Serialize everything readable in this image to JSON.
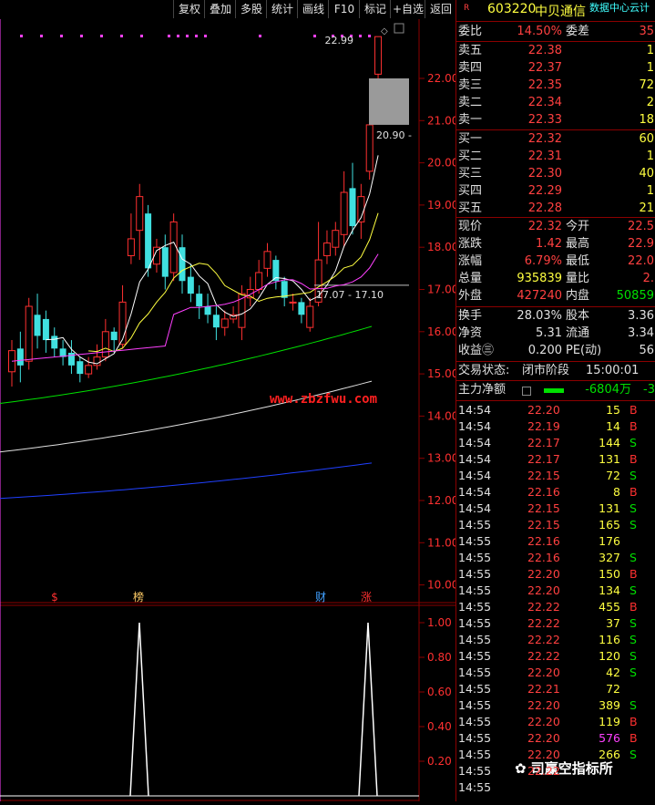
{
  "toolbar": {
    "buttons": [
      "复权",
      "叠加",
      "多股",
      "统计",
      "画线",
      "F10",
      "标记",
      "+自选",
      "返回"
    ]
  },
  "chart": {
    "price_axis_labels": [
      "22.00",
      "21.00",
      "20.00",
      "19.00",
      "18.00",
      "17.00",
      "16.00",
      "15.00",
      "14.00",
      "13.00",
      "12.00",
      "11.00",
      "10.00"
    ],
    "high_label": "22.99",
    "low_gap_label": "20.90 -",
    "ma_label": "17.07 - 17.10",
    "markers": [
      {
        "text": "$",
        "color": "#ff3030"
      },
      {
        "text": "榜",
        "color": "#ffcc66"
      },
      {
        "text": "财",
        "color": "#40a0ff"
      },
      {
        "text": "涨",
        "color": "#ff3030"
      }
    ],
    "indicator_axis_labels": [
      "1.00",
      "0.80",
      "0.60",
      "0.40",
      "0.20"
    ],
    "colors": {
      "up": "#ff3030",
      "down": "#40e0e0",
      "ma5": "#ffffff",
      "ma10": "#ffff40",
      "ma20": "#ff40ff",
      "ma60": "#00e000",
      "ma120": "#e0e0e0",
      "ma250": "#2040ff"
    }
  },
  "watermark": "www.zbzfwu.com",
  "wechat_label": "司赢空指标所",
  "quote": {
    "flag": "R",
    "code": "603220",
    "name": "中贝通信",
    "cloud": "数据中心云计",
    "weibi_label": "委比",
    "weibi_value": "14.50%",
    "weicha_label": "委差",
    "weicha_value": "35",
    "asks": [
      {
        "label": "卖五",
        "price": "22.38",
        "vol": "1"
      },
      {
        "label": "卖四",
        "price": "22.37",
        "vol": "1"
      },
      {
        "label": "卖三",
        "price": "22.35",
        "vol": "72"
      },
      {
        "label": "卖二",
        "price": "22.34",
        "vol": "2"
      },
      {
        "label": "卖一",
        "price": "22.33",
        "vol": "18"
      }
    ],
    "bids": [
      {
        "label": "买一",
        "price": "22.32",
        "vol": "60"
      },
      {
        "label": "买二",
        "price": "22.31",
        "vol": "1"
      },
      {
        "label": "买三",
        "price": "22.30",
        "vol": "40"
      },
      {
        "label": "买四",
        "price": "22.29",
        "vol": "1"
      },
      {
        "label": "买五",
        "price": "22.28",
        "vol": "21"
      }
    ],
    "stats": [
      {
        "l1": "现价",
        "v1": "22.32",
        "l2": "今开",
        "v2": "22.5"
      },
      {
        "l1": "涨跌",
        "v1": "1.42",
        "l2": "最高",
        "v2": "22.9"
      },
      {
        "l1": "涨幅",
        "v1": "6.79%",
        "l2": "最低",
        "v2": "22.0"
      },
      {
        "l1": "总量",
        "v1": "935839",
        "l2": "量比",
        "v2": "2."
      },
      {
        "l1": "外盘",
        "v1": "427240",
        "l2": "内盘",
        "v2": "50859"
      }
    ],
    "stats2": [
      {
        "l1": "换手",
        "v1": "28.03%",
        "l2": "股本",
        "v2": "3.36"
      },
      {
        "l1": "净资",
        "v1": "5.31",
        "l2": "流通",
        "v2": "3.34"
      },
      {
        "l1": "收益㊂",
        "v1": "0.200",
        "l2": "PE(动)",
        "v2": "56"
      }
    ],
    "status_label": "交易状态:",
    "status_value": "闭市阶段",
    "status_time": "15:00:01",
    "main_net_label": "主力净额",
    "main_net_value": "-6804万",
    "main_net_extra": "-3"
  },
  "ticks": [
    {
      "t": "14:54",
      "p": "22.20",
      "v": "15",
      "d": "B"
    },
    {
      "t": "14:54",
      "p": "22.19",
      "v": "14",
      "d": "B"
    },
    {
      "t": "14:54",
      "p": "22.17",
      "v": "144",
      "d": "S"
    },
    {
      "t": "14:54",
      "p": "22.17",
      "v": "131",
      "d": "B"
    },
    {
      "t": "14:54",
      "p": "22.15",
      "v": "72",
      "d": "S"
    },
    {
      "t": "14:54",
      "p": "22.16",
      "v": "8",
      "d": "B"
    },
    {
      "t": "14:54",
      "p": "22.15",
      "v": "131",
      "d": "S"
    },
    {
      "t": "14:55",
      "p": "22.15",
      "v": "165",
      "d": "S"
    },
    {
      "t": "14:55",
      "p": "22.16",
      "v": "176",
      "d": ""
    },
    {
      "t": "14:55",
      "p": "22.16",
      "v": "327",
      "d": "S"
    },
    {
      "t": "14:55",
      "p": "22.20",
      "v": "150",
      "d": "B"
    },
    {
      "t": "14:55",
      "p": "22.20",
      "v": "134",
      "d": "S"
    },
    {
      "t": "14:55",
      "p": "22.22",
      "v": "455",
      "d": "B"
    },
    {
      "t": "14:55",
      "p": "22.22",
      "v": "37",
      "d": "S"
    },
    {
      "t": "14:55",
      "p": "22.22",
      "v": "116",
      "d": "S"
    },
    {
      "t": "14:55",
      "p": "22.22",
      "v": "120",
      "d": "S"
    },
    {
      "t": "14:55",
      "p": "22.20",
      "v": "42",
      "d": "S"
    },
    {
      "t": "14:55",
      "p": "22.21",
      "v": "72",
      "d": ""
    },
    {
      "t": "14:55",
      "p": "22.20",
      "v": "389",
      "d": "S"
    },
    {
      "t": "14:55",
      "p": "22.20",
      "v": "119",
      "d": "B"
    },
    {
      "t": "14:55",
      "p": "22.20",
      "v": "576",
      "d": "B"
    },
    {
      "t": "14:55",
      "p": "22.20",
      "v": "266",
      "d": "S"
    },
    {
      "t": "14:55",
      "p": "22.22",
      "v": "",
      "d": ""
    },
    {
      "t": "14:55",
      "p": "",
      "v": "",
      "d": ""
    }
  ]
}
